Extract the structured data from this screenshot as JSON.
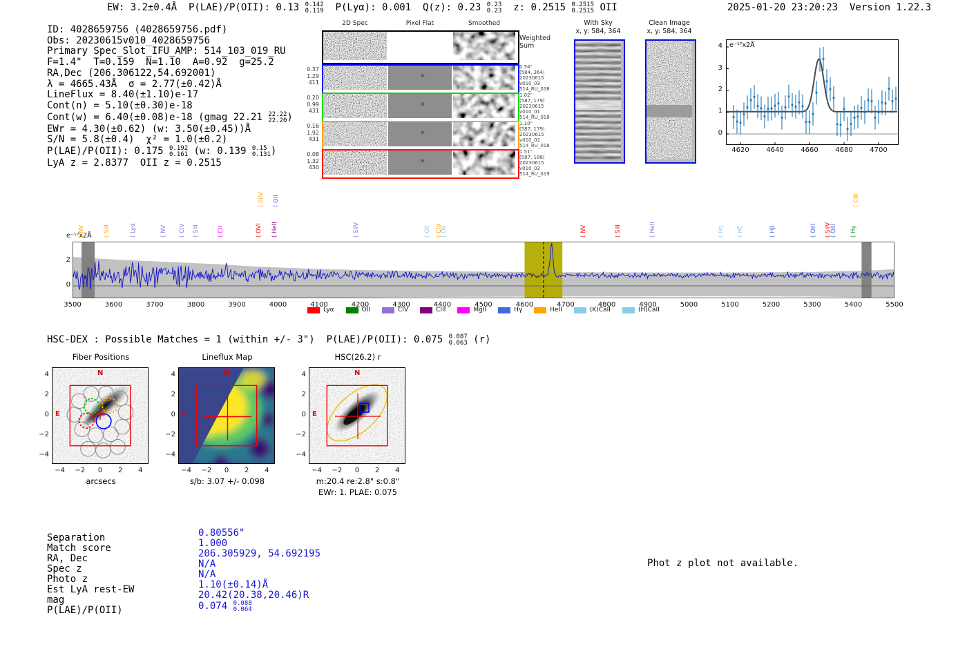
{
  "meta": {
    "timestamp": "2025-01-20 23:20:23  Version 1.22.3"
  },
  "top_stats": {
    "segments": [
      "EW: 3.2±0.4Å  P(LAE)/P(OII): 0.13 ",
      {
        "sup": "0.142",
        "sub": "0.119"
      },
      "  P(Lyα): 0.001  Q(z): 0.23 ",
      {
        "sup": "0.23",
        "sub": "0.23"
      },
      "  z: 0.2515 ",
      {
        "sup": "0.2515",
        "sub": "0.2515"
      },
      " OII"
    ]
  },
  "info_block": {
    "lines": [
      [
        "ID: 4028659756 (4028659756.pdf)"
      ],
      [
        "Obs: 20230615v010_4028659756"
      ],
      [
        "Primary Spec_Slot_IFU_AMP: 514_103_019_RU"
      ],
      [
        "F=1.4\"  T=0.159  N=1.10  A=0.92  g=25.2"
      ],
      [
        "RA,Dec (206.306122,54.692001)"
      ],
      [
        "λ = 4665.43Å  σ = 2.77(±0.42)Å"
      ],
      [
        "LineFlux = 8.40(±1.10)e-17"
      ],
      [
        "Cont(n) = 5.10(±0.30)e-18"
      ],
      [
        "Cont(w) = 6.40(±0.08)e-18 (gmag 22.21 ",
        {
          "sup": "22.22",
          "sub": "22.20"
        },
        ")"
      ],
      [
        "EWr = 4.30(±0.62) (w: 3.50(±0.45))Å"
      ],
      [
        "S/N = 5.8(±0.4)  χ² = 1.0(±0.2)"
      ],
      [
        "P(LAE)/P(OII): 0.175 ",
        {
          "sup": "0.192",
          "sub": "0.161"
        },
        " (w: 0.139 ",
        {
          "sup": "0.15",
          "sub": "0.131"
        },
        ")"
      ],
      [
        "LyA z = 2.8377  OII z = 0.2515"
      ]
    ]
  },
  "cutouts": {
    "col_headers": [
      "2D Spec",
      "Pixel Flat",
      "Smoothed"
    ],
    "weighted_label": "Weighted\nSum",
    "rows": [
      {
        "color": "#0000ff",
        "left": [
          "0.37",
          "1.29",
          "411"
        ],
        "right": [
          "0.54\"",
          "(584, 364)",
          "20230615",
          "v010_03",
          "514_RU_038"
        ]
      },
      {
        "color": "#00dd00",
        "left": [
          "0.20",
          "0.99",
          "431"
        ],
        "right": [
          "1.02\"",
          "(587, 179)",
          "20230615",
          "v010_01",
          "514_RU_018"
        ]
      },
      {
        "color": "#ffa500",
        "left": [
          "0.16",
          "1.92",
          "431"
        ],
        "right": [
          "1.10\"",
          "(587, 179)",
          "20230615",
          "v010_02",
          "514_RU_018"
        ]
      },
      {
        "color": "#ff1100",
        "left": [
          "0.08",
          "1.32",
          "430"
        ],
        "right": [
          "1.51\"",
          "(587, 188)",
          "20230615",
          "v010_02",
          "514_RU_019"
        ]
      }
    ]
  },
  "sky_panels": {
    "with_sky": {
      "title": "With Sky",
      "coords": "x, y: 584, 364"
    },
    "clean": {
      "title": "Clean Image",
      "coords": "x, y: 584, 364"
    }
  },
  "hsc": {
    "header_segments": [
      "HSC-DEX : Possible Matches = 1 (within +/- 3\")  P(LAE)/P(OII): 0.075 ",
      {
        "sup": "0.087",
        "sub": "0.063"
      },
      " (r)"
    ]
  },
  "aperture_panels": [
    {
      "title": "Fiber Positions",
      "xlabel": "arcsecs",
      "xticks": [
        "−4",
        "−2",
        "0",
        "2",
        "4"
      ],
      "yticks": [
        "4",
        "2",
        "0",
        "−2",
        "−4"
      ],
      "compass": {
        "n": "N",
        "e": "E"
      }
    },
    {
      "title": "Lineflux Map",
      "xlabel": "s/b: 3.07 +/- 0.098",
      "xticks": [
        "−4",
        "−2",
        "0",
        "2",
        "4"
      ],
      "yticks": [
        "4",
        "2",
        "0",
        "−2",
        "−4"
      ],
      "compass": {
        "n": "N",
        "e": "E"
      }
    },
    {
      "title": "HSC(26.2) r",
      "xlabel": "m:20.4  re:2.8\"  s:0.8\"",
      "xlabel2": "EWr: 1. PLAE: 0.075",
      "xticks": [
        "−4",
        "−2",
        "0",
        "2",
        "4"
      ],
      "yticks": [
        "4",
        "2",
        "0",
        "−2",
        "−4"
      ],
      "compass": {
        "n": "N",
        "e": "E"
      }
    }
  ],
  "match_table": {
    "rows": [
      {
        "label": "Separation",
        "value": "0.80556\""
      },
      {
        "label": "Match score",
        "value": "1.000"
      },
      {
        "label": "RA, Dec",
        "value": "206.305929, 54.692195"
      },
      {
        "label": "Spec z",
        "value": "N/A"
      },
      {
        "label": "Photo z",
        "value": "N/A"
      },
      {
        "label": "Est LyA rest-EW",
        "value": "1.10(±0.14)Å"
      },
      {
        "label": "mag",
        "value": "20.42(20.38,20.46)R"
      },
      {
        "label": "P(LAE)/P(OII)",
        "value": "0.074 ",
        "sup": "0.088",
        "sub": "0.064"
      }
    ]
  },
  "phot_z_note": "Phot z plot not available.",
  "chart_data": [
    {
      "id": "line_fit_zoom",
      "type": "scatter",
      "ylabel_annotation": "e⁻¹⁷x2Å",
      "xlim": [
        4611.6,
        4711.6
      ],
      "ylim": [
        -0.51,
        4.35
      ],
      "xticks": [
        4620,
        4640,
        4660,
        4680,
        4700
      ],
      "yticks": [
        0,
        1,
        2,
        3,
        4
      ],
      "x_start": 4616,
      "x_step": 2,
      "y": [
        0.78,
        0.57,
        0.52,
        0.9,
        1.22,
        1.55,
        1.7,
        1.28,
        1.18,
        0.8,
        1.15,
        1.17,
        1.3,
        1.4,
        0.75,
        1.22,
        1.72,
        1.33,
        1.25,
        1.45,
        1.27,
        0.55,
        0.55,
        0.92,
        1.9,
        3.42,
        3.45,
        2.42,
        2.05,
        1.65,
        0.45,
        0.42,
        1.15,
        0.22,
        0.45,
        0.75,
        0.8,
        1.2,
        1.0,
        1.55,
        1.5,
        0.75,
        1.0,
        1.45,
        1.4,
        2.08,
        1.5,
        1.62,
        1.25,
        1.05
      ],
      "yerr": 0.55,
      "marker_color": "#1f77b4",
      "fit": {
        "type": "gaussian",
        "baseline": 1.02,
        "amplitude": 2.43,
        "center": 4665.43,
        "sigma": 2.77,
        "color": "#4a4a4a"
      },
      "zero_line": true
    },
    {
      "id": "full_spectrum",
      "type": "line",
      "ylabel_annotation": "e⁻¹⁷x2Å",
      "xlim": [
        3500,
        5500
      ],
      "ylim": [
        -1.0,
        3.56
      ],
      "xticks": [
        3500,
        3600,
        3700,
        3800,
        3900,
        4000,
        4100,
        4200,
        4300,
        4400,
        4500,
        4600,
        4700,
        4800,
        4900,
        5000,
        5100,
        5200,
        5300,
        5400,
        5500
      ],
      "yticks": [
        0,
        2
      ],
      "line_color": "#1010d0",
      "baseline": 0.85,
      "noise_seed": 42,
      "series_note": "synthetic noise reproduction of observed spectrum; emission line at 4665.43",
      "emission_line": {
        "center": 4665.43,
        "sigma": 3.2,
        "amplitude": 2.55
      },
      "envelope": {
        "x": [
          3500,
          3560,
          3650,
          3750,
          3850,
          3950,
          4100,
          4300,
          4500,
          4700,
          4900,
          5100,
          5300,
          5450,
          5500
        ],
        "top": [
          2.35,
          2.2,
          2.05,
          1.9,
          1.75,
          1.55,
          1.35,
          1.22,
          1.15,
          1.1,
          1.08,
          1.08,
          1.12,
          1.25,
          1.35
        ]
      },
      "highlight_band": {
        "x_frac": [
          0.55,
          0.596
        ],
        "color": "#b3ac00"
      },
      "dashed_line_frac": 0.573,
      "masked_bands_frac": [
        [
          0.011,
          0.027
        ],
        [
          0.96,
          0.972
        ]
      ],
      "legend": [
        {
          "label": "Lyα",
          "color": "#ff0000"
        },
        {
          "label": "OII",
          "color": "#008000"
        },
        {
          "label": "CIV",
          "color": "#9370db"
        },
        {
          "label": "CIII",
          "color": "#800080"
        },
        {
          "label": "MgII",
          "color": "#ff00ff"
        },
        {
          "label": "Hγ",
          "color": "#4169e1"
        },
        {
          "label": "HeII",
          "color": "#ffa500"
        },
        {
          "label": "(K)CaII",
          "color": "#87ceeb"
        },
        {
          "label": "(H)CaII",
          "color": "#87ceeb"
        }
      ],
      "line_labels": [
        {
          "frac": 0.011,
          "text": "NV",
          "color": "#ffa500",
          "tier": "low"
        },
        {
          "frac": 0.042,
          "text": "SiII",
          "color": "#ffa500",
          "tier": "low"
        },
        {
          "frac": 0.074,
          "text": "Lyα",
          "color": "#9370db",
          "tier": "low"
        },
        {
          "frac": 0.111,
          "text": "NV",
          "color": "#9370db",
          "tier": "low"
        },
        {
          "frac": 0.134,
          "text": "CIV",
          "color": "#9370db",
          "tier": "low"
        },
        {
          "frac": 0.15,
          "text": "SiII",
          "color": "#9370db",
          "tier": "low"
        },
        {
          "frac": 0.181,
          "text": "CII",
          "color": "#ff00ff",
          "tier": "low"
        },
        {
          "frac": 0.227,
          "text": "OVI",
          "color": "#ff0000",
          "tier": "low"
        },
        {
          "frac": 0.229,
          "text": "SiIV",
          "color": "#ffa500",
          "tier": "high"
        },
        {
          "frac": 0.248,
          "text": "OII",
          "color": "#4169e1",
          "tier": "high"
        },
        {
          "frac": 0.246,
          "text": "HeII",
          "color": "#8b008b",
          "tier": "low"
        },
        {
          "frac": 0.345,
          "text": "SiIV",
          "color": "#9370db",
          "tier": "low"
        },
        {
          "frac": 0.432,
          "text": "OII",
          "color": "#87ceeb",
          "tier": "low"
        },
        {
          "frac": 0.446,
          "text": "CIV",
          "color": "#ffa500",
          "tier": "low"
        },
        {
          "frac": 0.452,
          "text": "OII",
          "color": "#87ceeb",
          "tier": "low"
        },
        {
          "frac": 0.622,
          "text": "NV",
          "color": "#ff0000",
          "tier": "low"
        },
        {
          "frac": 0.664,
          "text": "SiII",
          "color": "#ff0000",
          "tier": "low"
        },
        {
          "frac": 0.706,
          "text": "HeII",
          "color": "#9370db",
          "tier": "low"
        },
        {
          "frac": 0.789,
          "text": "Hη",
          "color": "#87ceeb",
          "tier": "low"
        },
        {
          "frac": 0.813,
          "text": "Hζ",
          "color": "#87ceeb",
          "tier": "low"
        },
        {
          "frac": 0.852,
          "text": "Hβ",
          "color": "#4169e1",
          "tier": "low"
        },
        {
          "frac": 0.902,
          "text": "OIII",
          "color": "#4169e1",
          "tier": "low"
        },
        {
          "frac": 0.919,
          "text": "SiIV",
          "color": "#ff0000",
          "tier": "low"
        },
        {
          "frac": 0.926,
          "text": "OIII",
          "color": "#4169e1",
          "tier": "low"
        },
        {
          "frac": 0.95,
          "text": "Hγ",
          "color": "#228b22",
          "tier": "low"
        },
        {
          "frac": 0.954,
          "text": "CIII",
          "color": "#ffa500",
          "tier": "high"
        }
      ]
    }
  ]
}
